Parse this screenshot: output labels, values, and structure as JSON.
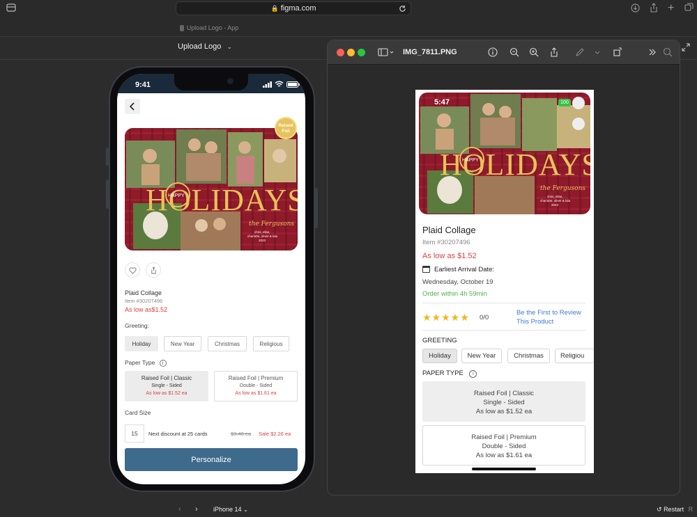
{
  "browser": {
    "url": "figma.com",
    "tab_title": "Upload Logo - App"
  },
  "prototype": {
    "frame_name": "Upload Logo",
    "device": "iPhone 14",
    "restart_label": "Restart",
    "restart_shortcut": "R"
  },
  "phone": {
    "time": "9:41",
    "badge_line1": "Raised",
    "badge_line2": "Foil",
    "product_name": "Plaid Collage",
    "item_number": "Item #30207496",
    "price_prefix": "As low as",
    "price": "$1.52",
    "greeting_label": "Greeting:",
    "greetings": [
      "Holiday",
      "New Year",
      "Christmas",
      "Religious"
    ],
    "paper_type_label": "Paper Type",
    "papers": [
      {
        "title": "Raised Foil | Classic",
        "sub": "Single - Sided",
        "price": "As low as $1.52 ea"
      },
      {
        "title": "Raised Foil | Premium",
        "sub": "Double - Sided",
        "price": "As low as $1.61 ea"
      }
    ],
    "card_size_label": "Card Size",
    "quantity": "15",
    "discount_text": "Next discount at 25 cards",
    "original_price": "$3.48 ea",
    "sale_price": "Sale $2.26 ea",
    "cta_label": "Personalize"
  },
  "card_art": {
    "happy": "HAPPY",
    "holidays": "HOLIDAYS",
    "family_name": "the Fergusons",
    "names_line1": "chris, elise,",
    "names_line2": "charlotte, oliver & lola",
    "year": "2023"
  },
  "preview": {
    "filename": "IMG_7811.PNG",
    "time": "5:47",
    "battery": "100",
    "product_name": "Plaid Collage",
    "item_number": "Item #30207496",
    "price": "As low as $1.52",
    "arrival_label": "Earliest Arrival Date:",
    "arrival_date": "Wednesday, October 19",
    "order_within": "Order within 4h 59min",
    "rating_count": "0/0",
    "review_line1": "Be the First to Review",
    "review_line2": "This Product",
    "greeting_heading": "GREETING",
    "greetings": [
      "Holiday",
      "New Year",
      "Christmas",
      "Religiou"
    ],
    "paper_heading": "PAPER TYPE",
    "papers": [
      {
        "title": "Raised Foil | Classic",
        "sub": "Single - Sided",
        "price": "As low as $1.52 ea"
      },
      {
        "title": "Raised Foil | Premium",
        "sub": "Double - Sided",
        "price": "As low as $1.61 ea"
      }
    ]
  },
  "colors": {
    "sale_red": "#d9413f",
    "cta_blue": "#3e6a8c",
    "green": "#4caf50",
    "link_blue": "#3b7bd1",
    "star_gold": "#f3b51b",
    "card_red": "#8e1a2a",
    "foil_gold": "#e8c25a"
  }
}
